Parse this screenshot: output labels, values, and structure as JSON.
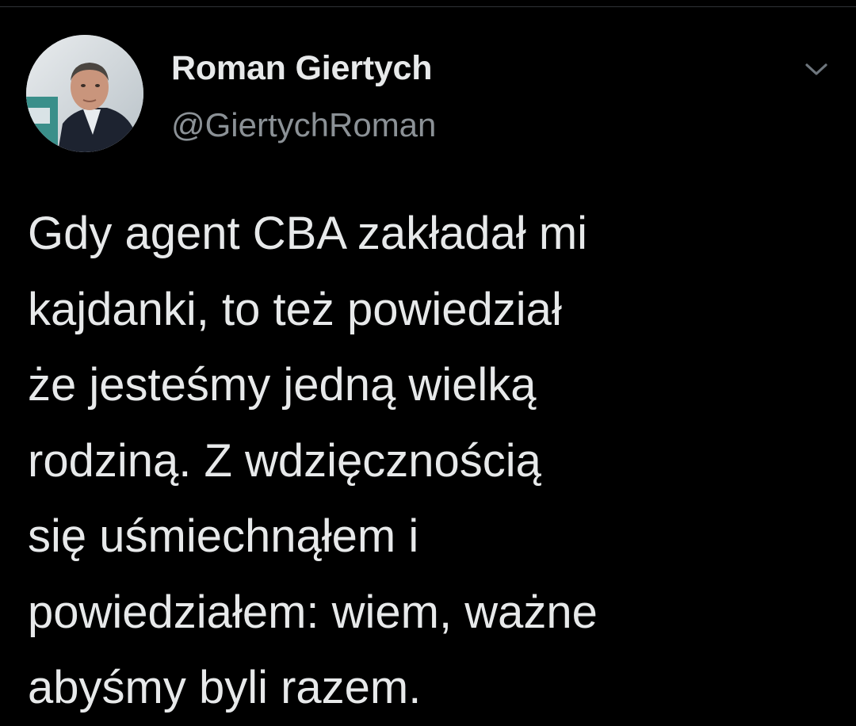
{
  "tweet": {
    "author": {
      "display_name": "Roman Giertych",
      "handle": "@GiertychRoman",
      "avatar": "user-avatar-photo"
    },
    "more_icon": "chevron-down-icon",
    "text_lines": [
      "Gdy agent CBA zakładał mi",
      "kajdanki, to też powiedział",
      "że jesteśmy jedną wielką",
      "rodziną. Z wdzięcznością",
      "się uśmiechnąłem i",
      "powiedziałem: wiem, ważne",
      "abyśmy byli razem."
    ]
  },
  "colors": {
    "background": "#000000",
    "primary_text": "#e7e9ea",
    "secondary_text": "#8b9196",
    "divider": "#2f3336"
  }
}
